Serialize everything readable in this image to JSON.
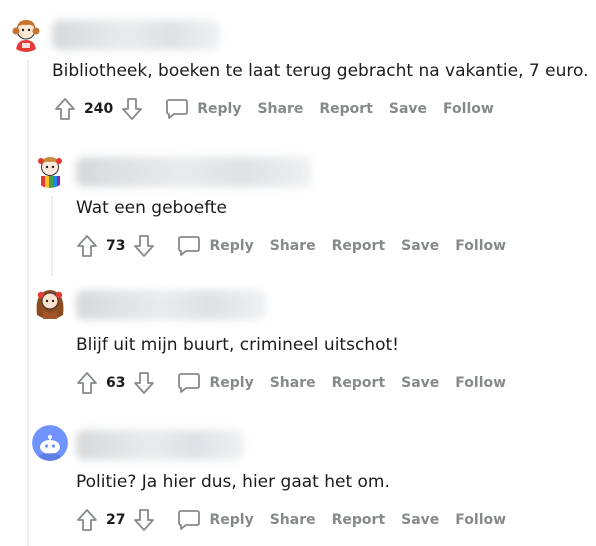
{
  "comments": [
    {
      "text": "Bibliotheek, boeken te laat terug gebracht na vakantie, 7 euro.",
      "score": "240",
      "actions": {
        "reply": "Reply",
        "share": "Share",
        "report": "Report",
        "save": "Save",
        "follow": "Follow"
      }
    },
    {
      "text": "Wat een geboefte",
      "score": "73",
      "actions": {
        "reply": "Reply",
        "share": "Share",
        "report": "Report",
        "save": "Save",
        "follow": "Follow"
      }
    },
    {
      "text": "Blijf uit mijn buurt, crimineel uitschot!",
      "score": "63",
      "actions": {
        "reply": "Reply",
        "share": "Share",
        "report": "Report",
        "save": "Save",
        "follow": "Follow"
      }
    },
    {
      "text": "Politie? Ja hier dus, hier gaat het om.",
      "score": "27",
      "actions": {
        "reply": "Reply",
        "share": "Share",
        "report": "Report",
        "save": "Save",
        "follow": "Follow"
      }
    }
  ],
  "icons": {
    "upvote": "upvote-arrow-icon",
    "downvote": "downvote-arrow-icon",
    "reply": "speech-bubble-icon"
  },
  "colors": {
    "action_text": "#878a8c",
    "icon_stroke": "#878a8c",
    "thread_line": "#edeff1",
    "default_avatar": "#7193ff"
  }
}
